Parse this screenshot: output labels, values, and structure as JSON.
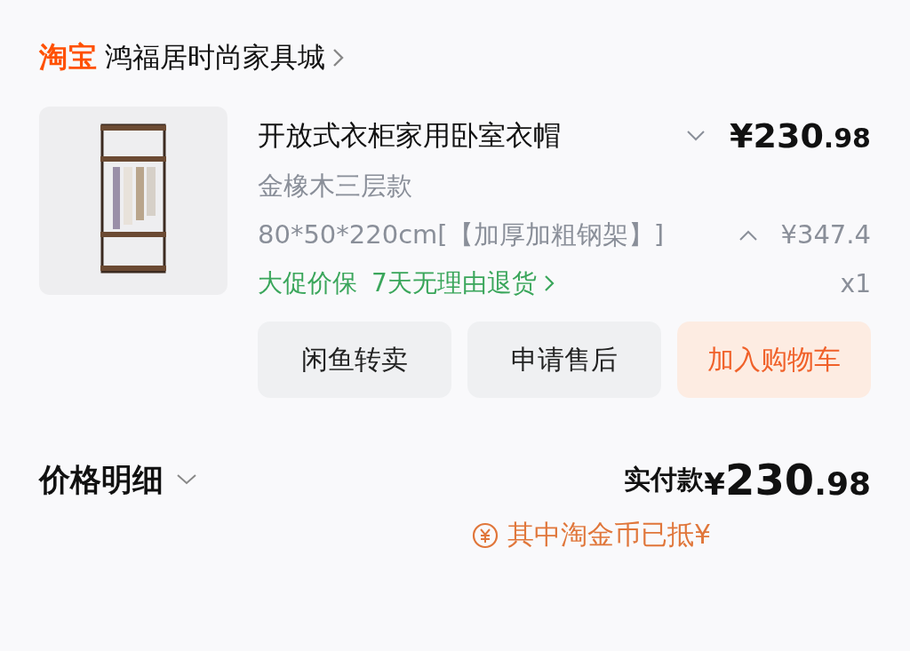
{
  "shop": {
    "logo": "淘宝",
    "name": "鸿福居时尚家具城"
  },
  "item": {
    "title": "开放式衣柜家用卧室衣帽",
    "price_symbol": "¥",
    "price_integer": "230",
    "price_decimal": ".98",
    "variant": "金橡木三层款",
    "spec": "80*50*220cm[【加厚加粗钢架】]",
    "original_price": "¥347.4",
    "tags": [
      "大促价保",
      "7天无理由退货"
    ],
    "quantity": "x1"
  },
  "buttons": [
    {
      "label": "闲鱼转卖",
      "kind": "plain"
    },
    {
      "label": "申请售后",
      "kind": "plain"
    },
    {
      "label": "加入购物车",
      "kind": "primary"
    }
  ],
  "price_detail": {
    "label": "价格明细",
    "total_label": "实付款",
    "total_symbol": "¥",
    "total_integer": "230",
    "total_decimal": ".98",
    "coin_note": "其中淘金币已抵¥"
  }
}
